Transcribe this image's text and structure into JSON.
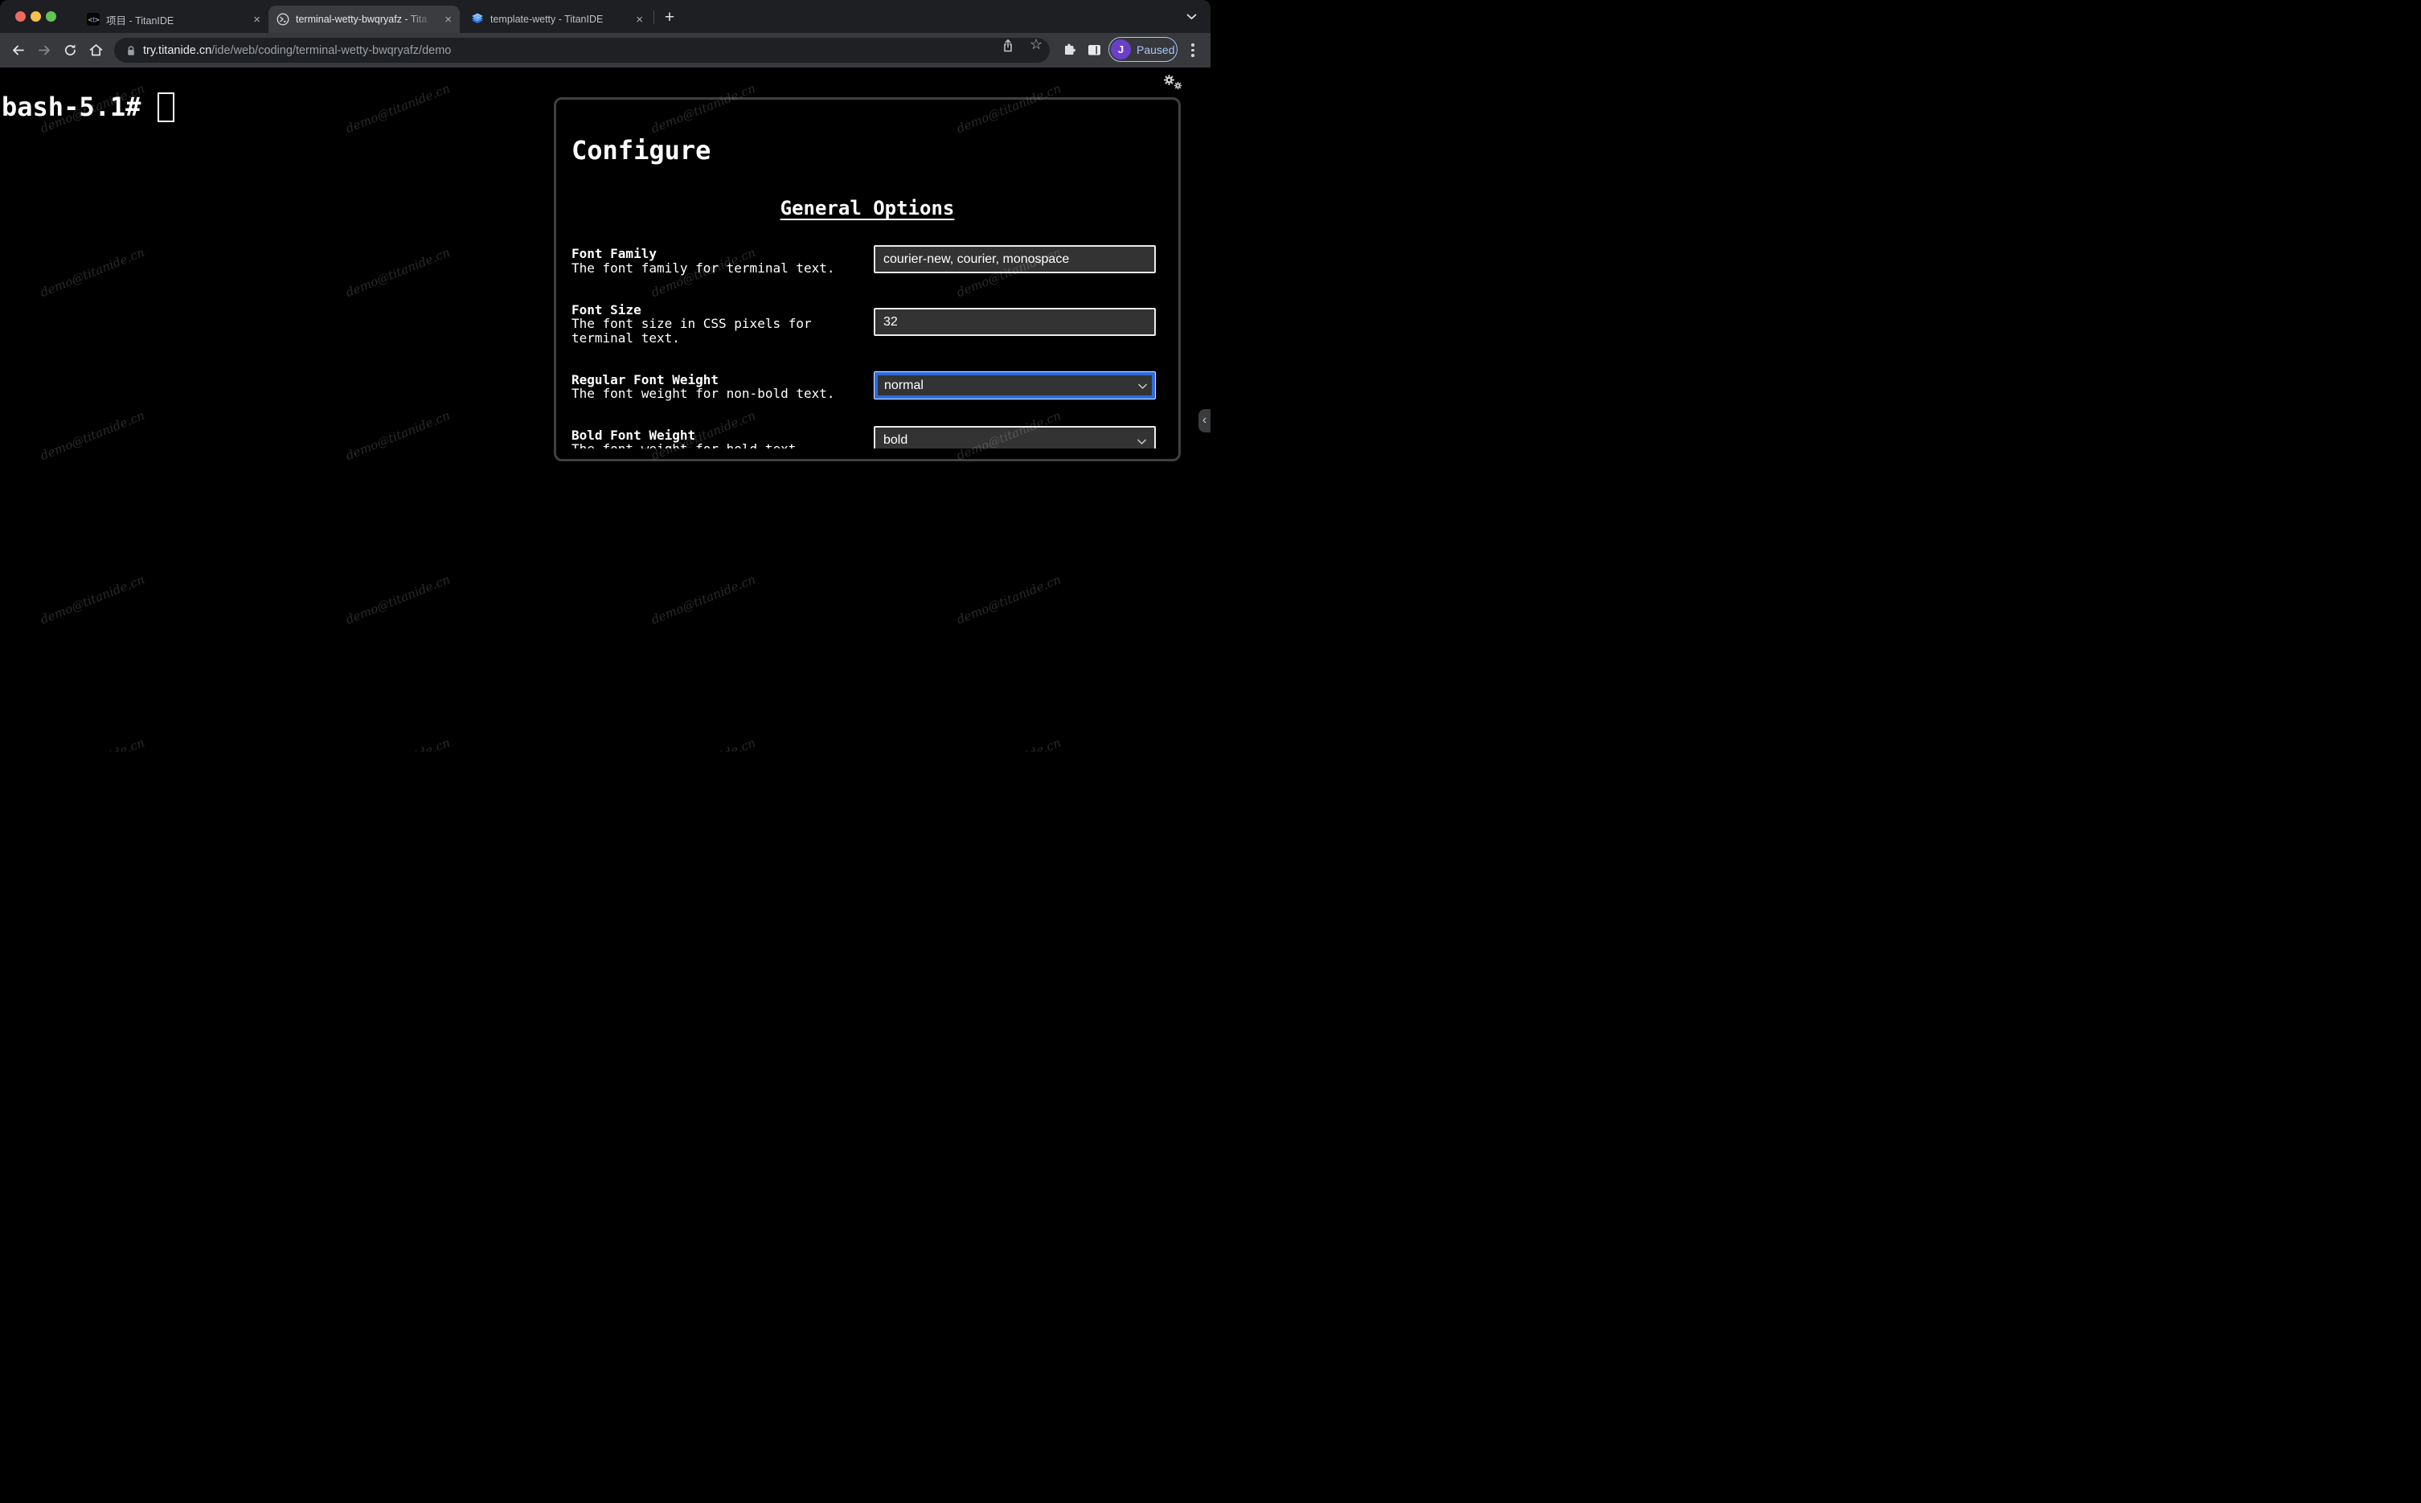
{
  "browser": {
    "tabs": [
      {
        "title": "项目 - TitanIDE"
      },
      {
        "title": "terminal-wetty-bwqryafz - Tita"
      },
      {
        "title": "template-wetty - TitanIDE"
      }
    ],
    "new_tab_label": "+",
    "address": {
      "host": "try.titanide.cn",
      "path": "/ide/web/coding/terminal-wetty-bwqryafz/demo"
    },
    "profile": {
      "initial": "J",
      "label": "Paused"
    },
    "colors": {
      "traffic_close": "#ee6a5f",
      "traffic_minimize": "#f5bf4f",
      "traffic_zoom": "#61c454",
      "profile_accent": "#a8c7fa",
      "avatar_purple": "#6b3fc9",
      "focus_ring_blue": "#2d6be1"
    }
  },
  "terminal": {
    "prompt": "bash-5.1#"
  },
  "watermark": {
    "text": "demo@titanide.cn"
  },
  "configure": {
    "title": "Configure",
    "section_heading": "General Options",
    "fields": [
      {
        "label": "Font Family",
        "description": "The font family for terminal text.",
        "type": "text",
        "value": "courier-new, courier, monospace"
      },
      {
        "label": "Font Size",
        "description": "The font size in CSS pixels for terminal text.",
        "type": "text",
        "value": "32"
      },
      {
        "label": "Regular Font Weight",
        "description": "The font weight for non-bold text.",
        "type": "select",
        "value": "normal",
        "focused": true
      },
      {
        "label": "Bold Font Weight",
        "description": "The font weight for bold text.",
        "type": "select",
        "value": "bold",
        "focused": false
      }
    ]
  }
}
